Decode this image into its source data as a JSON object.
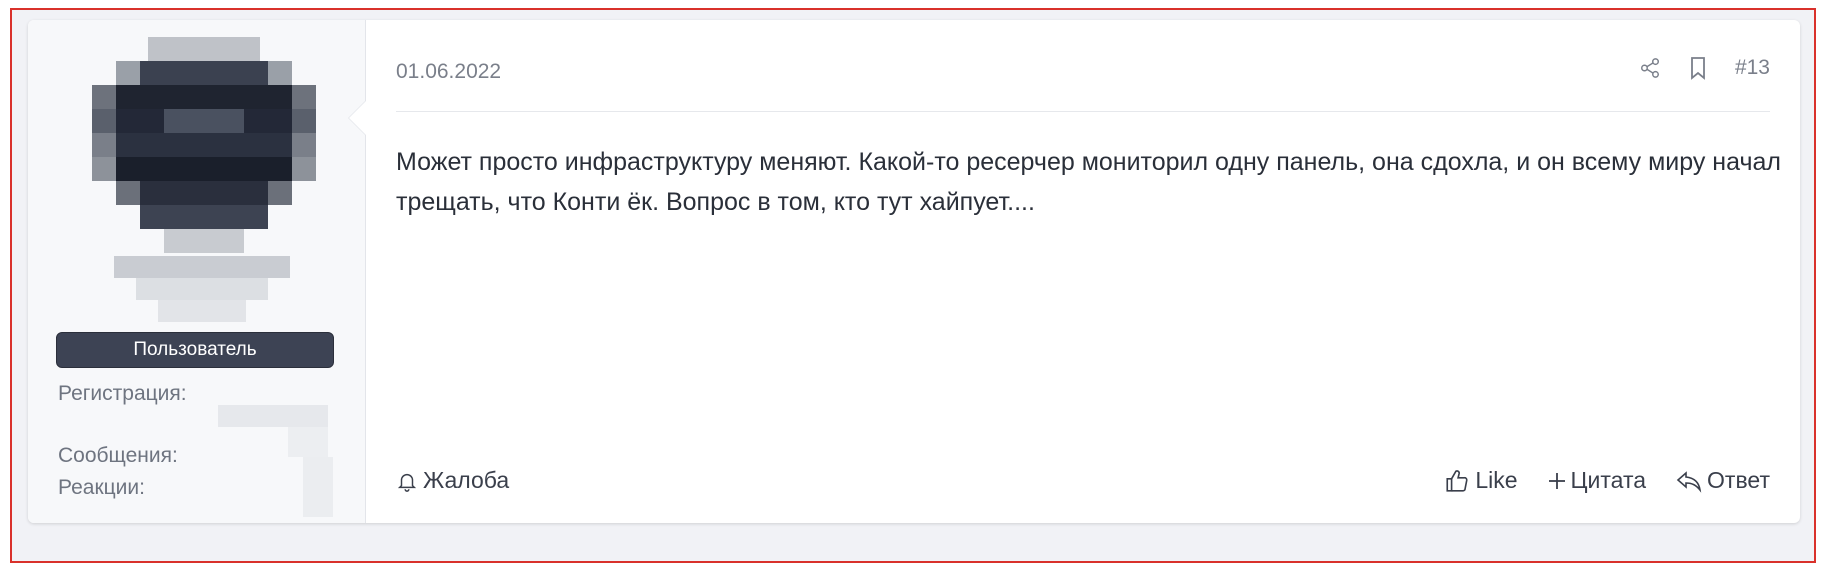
{
  "post": {
    "date": "01.06.2022",
    "number": "#13",
    "body": "Может просто инфраструктуру меняют. Какой-то ресерчер мониторил одну панель, она сдохла, и он всему миру начал трещать, что Конти ёк. Вопрос в том, кто тут хайпует....",
    "report_label": "Жалоба",
    "like_label": "Like",
    "quote_label": "Цитата",
    "reply_label": "Ответ"
  },
  "user": {
    "role": "Пользователь",
    "registration_label": "Регистрация:",
    "messages_label": "Сообщения:",
    "reactions_label": "Реакции:"
  },
  "icons": {
    "share": "share-icon",
    "bookmark": "bookmark-icon",
    "report": "bell-icon",
    "like": "thumbs-up-icon",
    "quote": "plus-icon",
    "reply": "reply-arrow-icon"
  },
  "colors": {
    "frame_border": "#d9312b",
    "role_badge": "#3d4354",
    "page_background": "#f1f2f6"
  }
}
